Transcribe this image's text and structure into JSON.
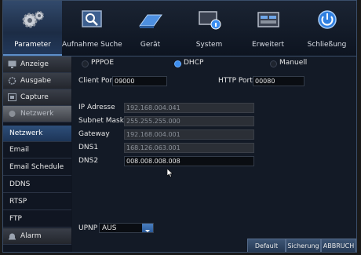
{
  "toolbar": {
    "items": [
      {
        "label": "Parameter",
        "icon": "gears-icon"
      },
      {
        "label": "Aufnahme Suche",
        "icon": "search-icon"
      },
      {
        "label": "Gerät",
        "icon": "hard-drive-icon"
      },
      {
        "label": "System",
        "icon": "system-info-icon"
      },
      {
        "label": "Erweitert",
        "icon": "advanced-icon"
      },
      {
        "label": "Schließung",
        "icon": "power-icon"
      }
    ]
  },
  "sidebar": {
    "items": [
      {
        "label": "Anzeige",
        "icon": "monitor-icon"
      },
      {
        "label": "Ausgabe",
        "icon": "output-icon"
      },
      {
        "label": "Capture",
        "icon": "capture-icon"
      },
      {
        "label": "Netzwerk",
        "icon": "network-icon"
      },
      {
        "label": "Netzwerk"
      },
      {
        "label": "Email"
      },
      {
        "label": "Email Schedule"
      },
      {
        "label": "DDNS"
      },
      {
        "label": "RTSP"
      },
      {
        "label": "FTP"
      },
      {
        "label": "Alarm",
        "icon": "alarm-icon"
      }
    ]
  },
  "network": {
    "mode_options": [
      "PPPOE",
      "DHCP",
      "Manuell"
    ],
    "mode_selected": "DHCP",
    "client_port_label": "Client Port",
    "client_port": "09000",
    "http_port_label": "HTTP Port",
    "http_port": "00080",
    "ip_label": "IP Adresse",
    "ip": "192.168.004.041",
    "subnet_label": "Subnet Maske",
    "subnet": "255.255.255.000",
    "gateway_label": "Gateway",
    "gateway": "192.168.004.001",
    "dns1_label": "DNS1",
    "dns1": "168.126.063.001",
    "dns2_label": "DNS2",
    "dns2": "008.008.008.008",
    "upnp_label": "UPNP",
    "upnp_value": "AUS"
  },
  "buttons": {
    "default": "Default",
    "save": "Sicherung",
    "cancel": "ABBRUCH"
  },
  "colors": {
    "accent": "#3c8ef0",
    "toolbar_bg": "#1b2433",
    "selected_item": "#2e4f7a"
  }
}
